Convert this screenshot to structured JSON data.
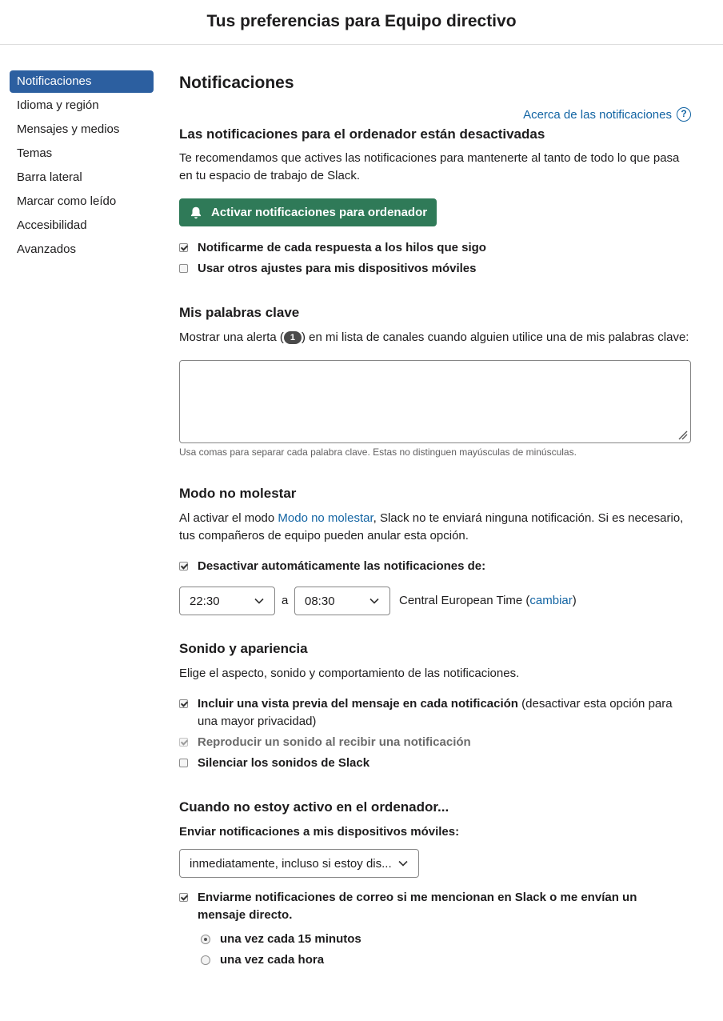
{
  "header": {
    "title": "Tus preferencias para Equipo directivo"
  },
  "sidebar": {
    "items": [
      {
        "label": "Notificaciones",
        "active": true
      },
      {
        "label": "Idioma y región"
      },
      {
        "label": "Mensajes y medios"
      },
      {
        "label": "Temas"
      },
      {
        "label": "Barra lateral"
      },
      {
        "label": "Marcar como leído"
      },
      {
        "label": "Accesibilidad"
      },
      {
        "label": "Avanzados"
      }
    ]
  },
  "main": {
    "title": "Notificaciones",
    "about_link": "Acerca de las notificaciones",
    "desktop": {
      "heading": "Las notificaciones para el ordenador están desactivadas",
      "description": "Te recomendamos que actives las notificaciones para mantenerte al tanto de todo lo que pasa en tu espacio de trabajo de Slack.",
      "enable_button": "Activar notificaciones para ordenador",
      "option_threads": {
        "label": "Notificarme de cada respuesta a los hilos que sigo",
        "checked": true
      },
      "option_mobile": {
        "label": "Usar otros ajustes para mis dispositivos móviles",
        "checked": false
      }
    },
    "keywords": {
      "heading": "Mis palabras clave",
      "desc_before": "Mostrar una alerta (",
      "badge": "1",
      "desc_after": ") en mi lista de canales cuando alguien utilice una de mis palabras clave:",
      "value": "",
      "hint": "Usa comas para separar cada palabra clave. Estas no distinguen mayúsculas de minúsculas."
    },
    "dnd": {
      "heading": "Modo no molestar",
      "desc_before": "Al activar el modo ",
      "desc_link": "Modo no molestar",
      "desc_after": ", Slack no te enviará ninguna notificación. Si es necesario, tus compañeros de equipo pueden anular esta opción.",
      "auto_label": "Desactivar automáticamente las notificaciones de:",
      "auto_checked": true,
      "from": "22:30",
      "separator": "a",
      "to": "08:30",
      "timezone": "Central European Time (",
      "change_link": "cambiar",
      "timezone_close": ")"
    },
    "sound": {
      "heading": "Sonido y apariencia",
      "description": "Elige el aspecto, sonido y comportamiento de las notificaciones.",
      "preview_label": "Incluir una vista previa del mensaje en cada notificación",
      "preview_note": " (desactivar esta opción para una mayor privacidad)",
      "preview_checked": true,
      "play_sound_label": "Reproducir un sonido al recibir una notificación",
      "play_sound_checked": true,
      "mute_label": "Silenciar los sonidos de Slack",
      "mute_checked": false
    },
    "inactive": {
      "heading": "Cuando no estoy activo en el ordenador...",
      "mobile_label": "Enviar notificaciones a mis dispositivos móviles:",
      "mobile_value": "inmediatamente, incluso si estoy dis...",
      "email_label": "Enviarme notificaciones de correo si me mencionan en Slack o me envían un mensaje directo.",
      "email_checked": true,
      "freq_options": [
        {
          "label": "una vez cada 15 minutos",
          "selected": true
        },
        {
          "label": "una vez cada hora",
          "selected": false
        }
      ]
    }
  },
  "colors": {
    "accent": "#2c5fa0",
    "button_green": "#2f7a58",
    "link": "#1264a3"
  }
}
